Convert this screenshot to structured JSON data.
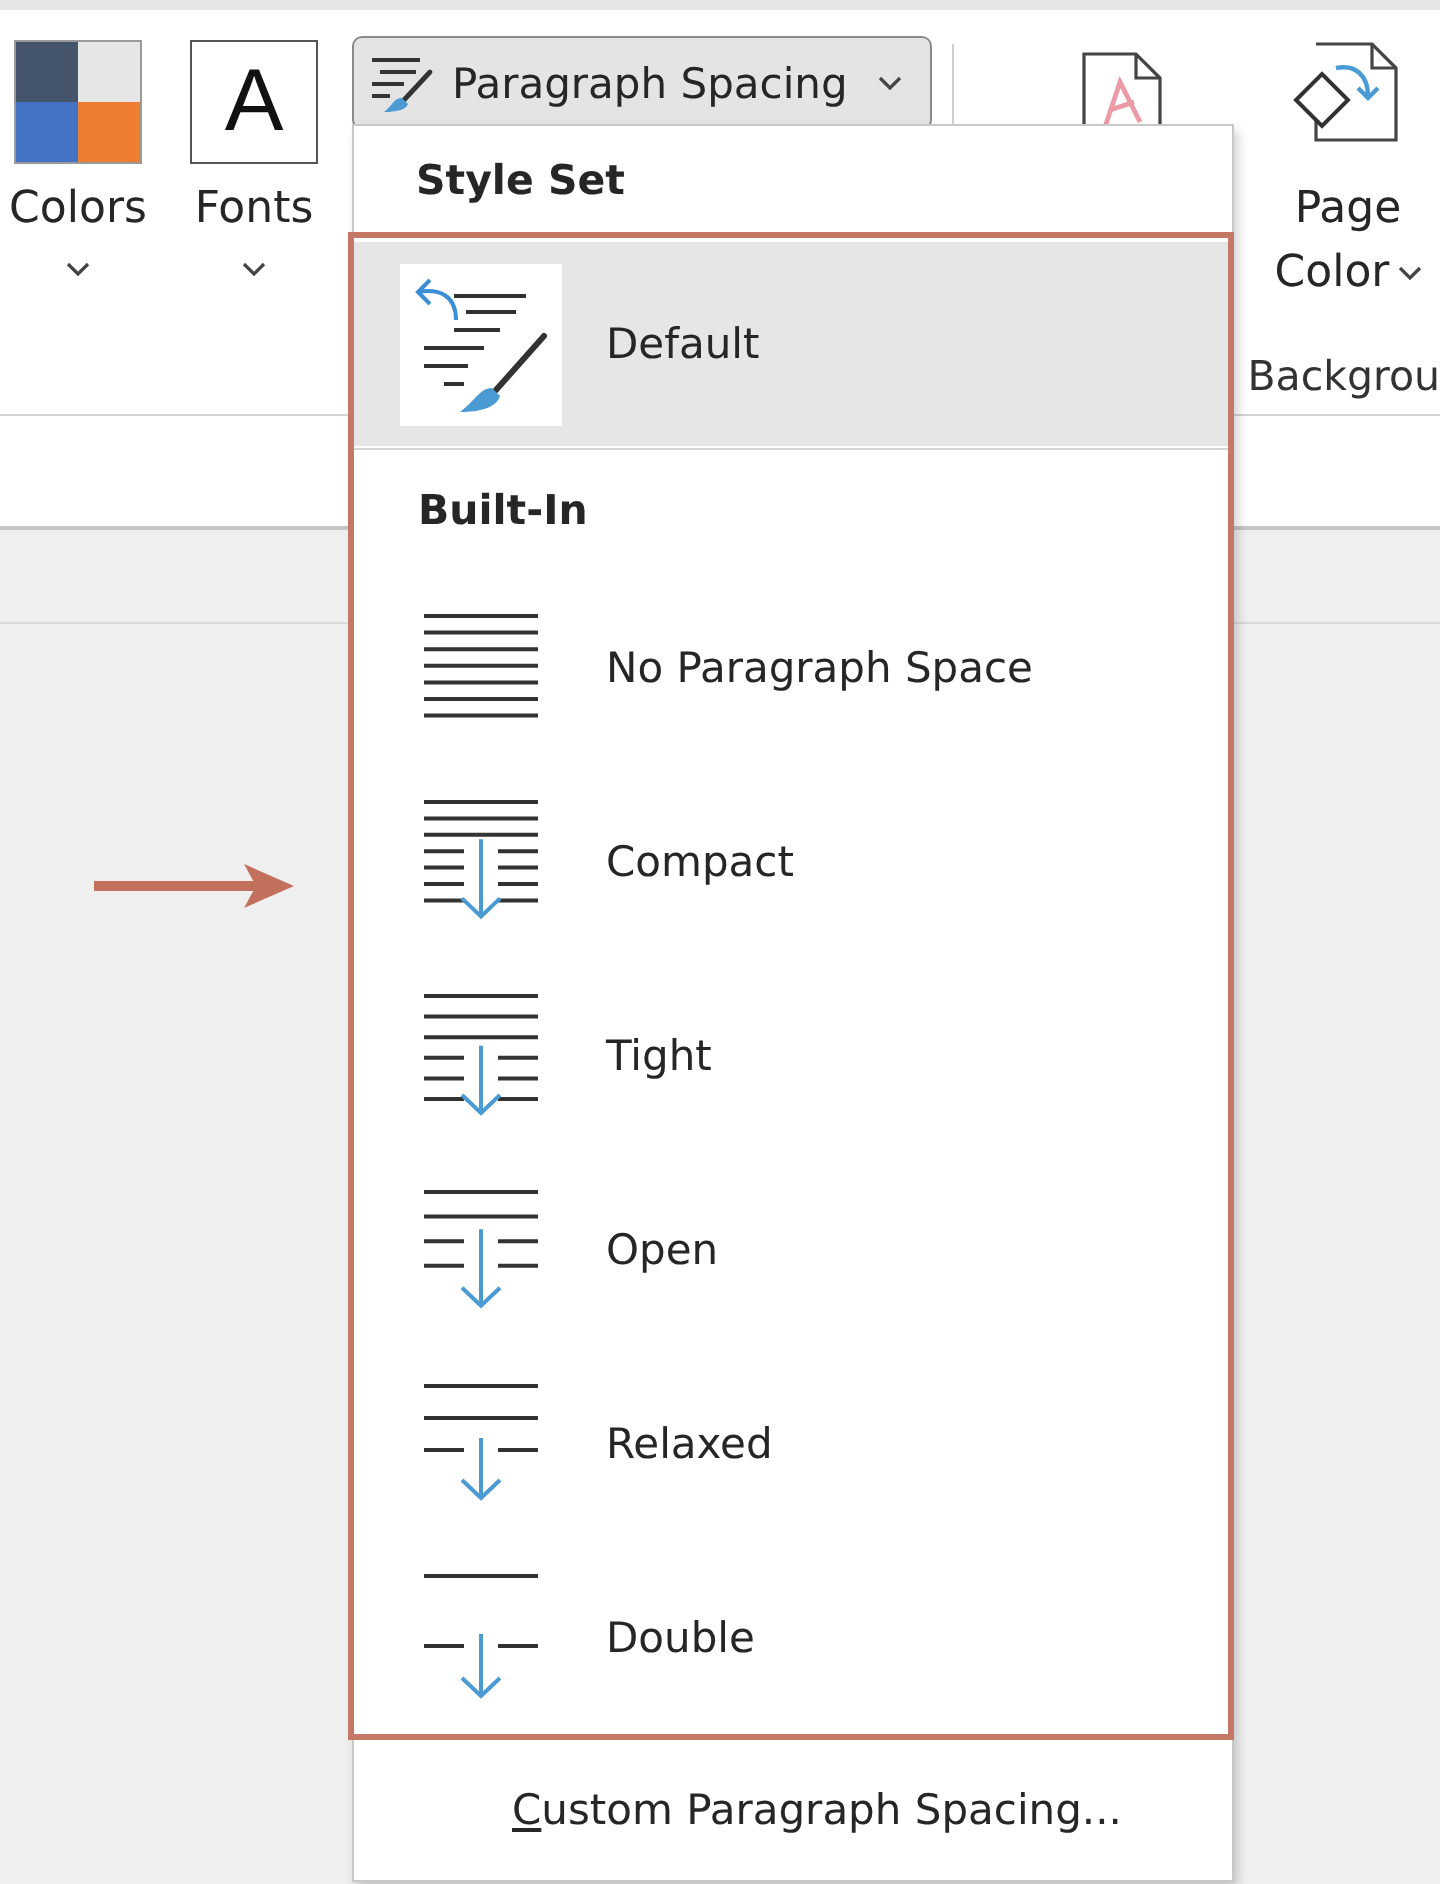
{
  "ribbon": {
    "buttons": [
      {
        "kind": "colors",
        "label": "Colors"
      },
      {
        "kind": "fonts",
        "label": "Fonts",
        "glyph": "A"
      }
    ],
    "paragraph_spacing": {
      "label": "Paragraph Spacing",
      "expanded": true
    },
    "page_color": {
      "label_lines": [
        "Page",
        "Color"
      ]
    },
    "group_label": "Backgrou"
  },
  "menu": {
    "sections": [
      {
        "header": "Style Set",
        "items": [
          {
            "kind": "default",
            "label": "Default",
            "selected": true
          }
        ]
      },
      {
        "header": "Built-In",
        "items": [
          {
            "kind": "none",
            "label": "No Paragraph Space",
            "selected": false
          },
          {
            "kind": "compact",
            "label": "Compact",
            "selected": false
          },
          {
            "kind": "tight",
            "label": "Tight",
            "selected": false
          },
          {
            "kind": "open",
            "label": "Open",
            "selected": false
          },
          {
            "kind": "relaxed",
            "label": "Relaxed",
            "selected": false
          },
          {
            "kind": "double",
            "label": "Double",
            "selected": false
          }
        ]
      }
    ],
    "footer": {
      "label": "Custom Paragraph Spacing...",
      "access_key_underlined": true
    }
  }
}
